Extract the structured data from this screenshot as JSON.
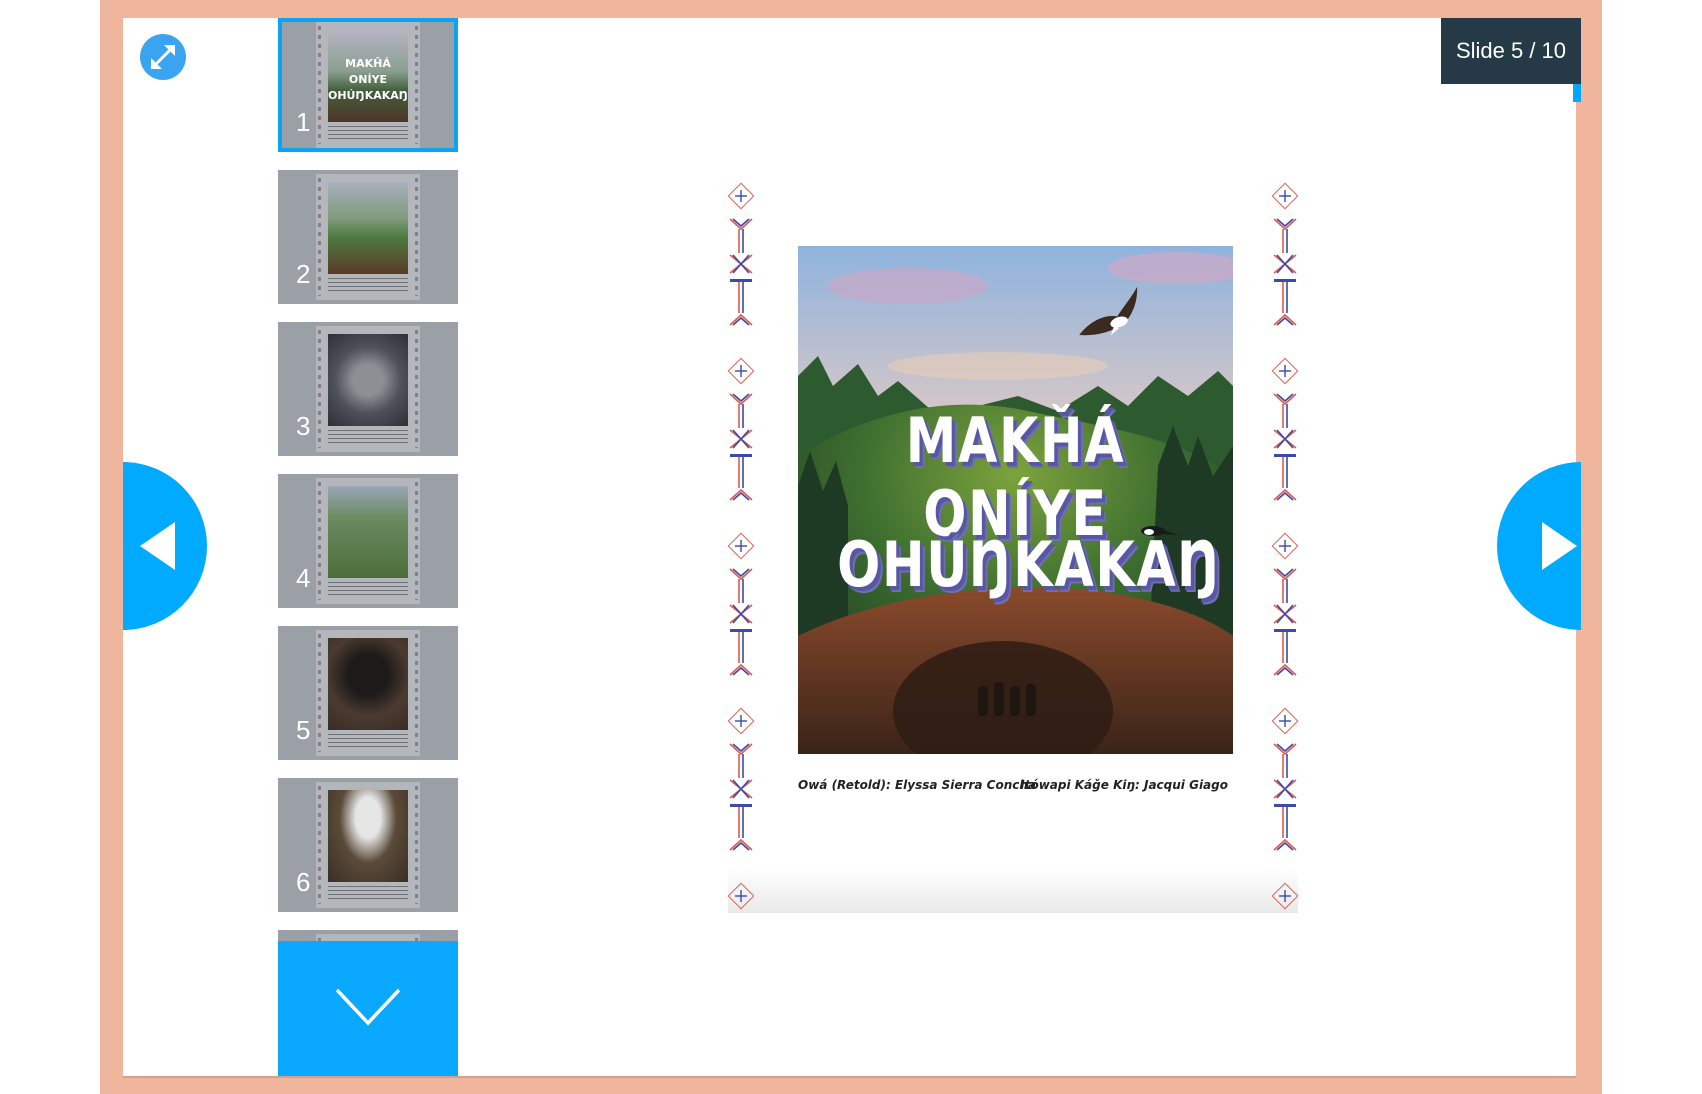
{
  "slide_counter": "Slide 5 / 10",
  "book": {
    "title_line1": "MAKȞÁ ONÍYE",
    "title_line2": "OHÚŊKAKAŊ",
    "credit_left": "Owá (Retold): Elyssa Sierra Concha",
    "credit_right": "Itówapi Káǧe Kiŋ: Jacqui Giago"
  },
  "thumbnails": [
    {
      "number": "1",
      "active": true
    },
    {
      "number": "2",
      "active": false
    },
    {
      "number": "3",
      "active": false
    },
    {
      "number": "4",
      "active": false
    },
    {
      "number": "5",
      "active": false
    },
    {
      "number": "6",
      "active": false
    }
  ],
  "thumbnail_cover_title": "MAKȞÁ ONÍYE OHÚŊKAKAŊ",
  "icons": {
    "fullscreen": "expand-arrows-icon",
    "prev": "triangle-left-icon",
    "next": "triangle-right-icon",
    "thumbs_down": "chevron-down-icon"
  },
  "colors": {
    "frame": "#efb59d",
    "accent": "#00aaff",
    "counter_bg": "#253a46",
    "thumb_bg": "#9aa0a6"
  }
}
